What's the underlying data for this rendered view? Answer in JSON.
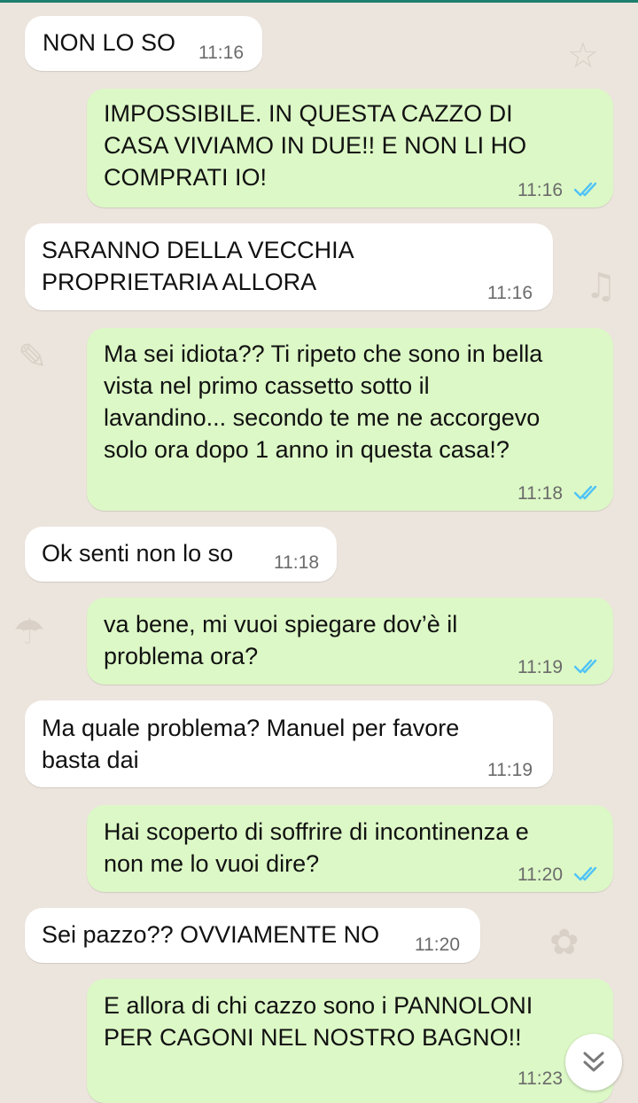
{
  "messages": [
    {
      "direction": "in",
      "text": "NON LO SO",
      "time": "11:16"
    },
    {
      "direction": "out",
      "text": "IMPOSSIBILE. IN QUESTA CAZZO DI\nCASA VIVIAMO IN DUE!! E NON LI HO\nCOMPRATI IO!",
      "time": "11:16",
      "status": "read"
    },
    {
      "direction": "in",
      "text": "SARANNO DELLA VECCHIA\nPROPRIETARIA ALLORA",
      "time": "11:16"
    },
    {
      "direction": "out",
      "text": "Ma sei idiota?? Ti ripeto che sono in bella\nvista nel primo cassetto sotto il\nlavandino... secondo te me ne accorgevo\nsolo ora dopo 1 anno in questa casa!?",
      "time": "11:18",
      "status": "read"
    },
    {
      "direction": "in",
      "text": "Ok senti non lo so",
      "time": "11:18"
    },
    {
      "direction": "out",
      "text": "va bene, mi vuoi spiegare dov’è il\nproblema ora?",
      "time": "11:19",
      "status": "read"
    },
    {
      "direction": "in",
      "text": "Ma quale problema? Manuel per favore\nbasta dai",
      "time": "11:19"
    },
    {
      "direction": "out",
      "text": "Hai scoperto di soffrire di incontinenza e\nnon me lo vuoi dire?",
      "time": "11:20",
      "status": "read"
    },
    {
      "direction": "in",
      "text": "Sei pazzo?? OVVIAMENTE NO",
      "time": "11:20"
    },
    {
      "direction": "out",
      "text": "E allora di chi cazzo sono i PANNOLONI\nPER CAGONI NEL NOSTRO BAGNO!!",
      "time": "11:23",
      "status": "read"
    }
  ],
  "colors": {
    "incoming": "#ffffff",
    "outgoing": "#dcf8c6",
    "read_ticks": "#4fc3f7",
    "background": "#ece5dd"
  },
  "icons": {
    "read": "double-check-icon",
    "scroll": "chevron-double-down-icon"
  }
}
